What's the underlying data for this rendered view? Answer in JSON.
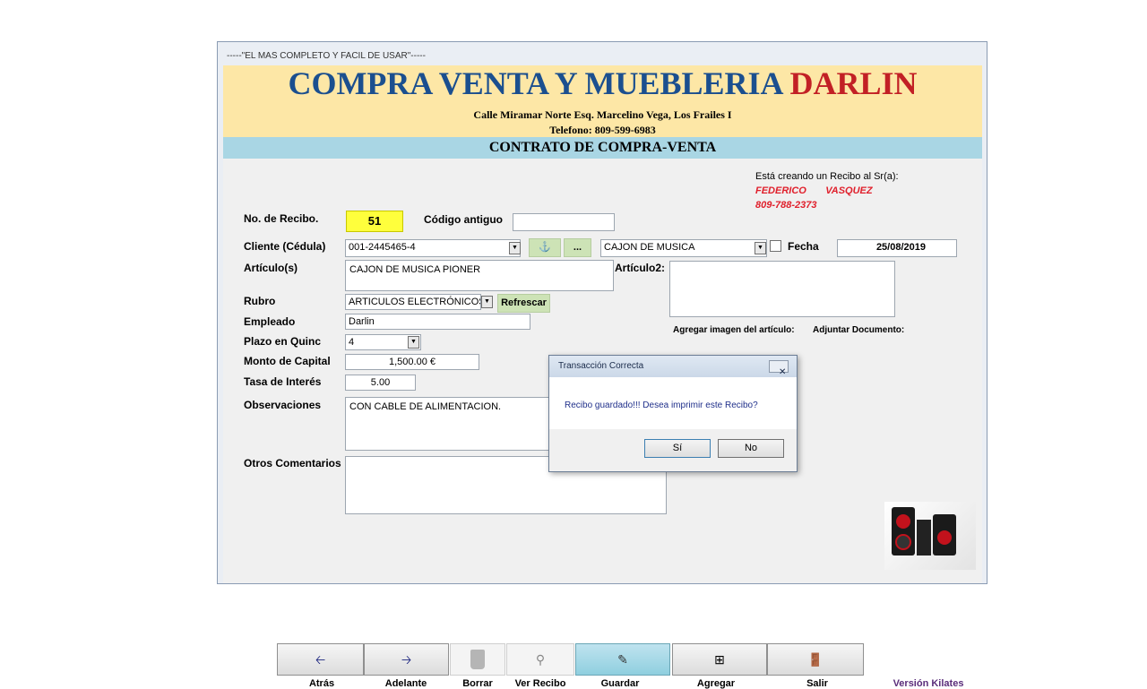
{
  "window": {
    "title": "-----\"EL MAS COMPLETO Y FACIL DE USAR\"-----"
  },
  "header": {
    "brand_main": "COMPRA VENTA Y MUEBLERIA ",
    "brand_accent": "DARLIN",
    "address": "Calle Miramar Norte Esq. Marcelino Vega, Los Frailes I",
    "phone": "Telefono: 809-599-6983",
    "banner": "CONTRATO DE COMPRA-VENTA"
  },
  "info": {
    "creating_text": "Está creando un Recibo al Sr(a):",
    "client_name": "FEDERICO       VASQUEZ",
    "client_phone": "809-788-2373"
  },
  "form": {
    "recibo_label": "No. de Recibo.",
    "recibo_value": "51",
    "codigo_label": "Código antiguo",
    "codigo_value": "",
    "cliente_label": "Cliente (Cédula)",
    "cliente_value": "001-2445465-4",
    "article_select_value": "CAJON DE MUSICA",
    "ellipsis_label": "...",
    "fecha_label": "Fecha",
    "fecha_value": "25/08/2019",
    "articulos_label": "Artículo(s)",
    "articulos_value": "CAJON DE MUSICA PIONER",
    "articulo2_label": "Artículo2:",
    "articulo2_value": "",
    "rubro_label": "Rubro",
    "rubro_value": "ARTICULOS ELECTRÓNICOS",
    "refrescar_label": "Refrescar",
    "empleado_label": "Empleado",
    "empleado_value": "Darlin",
    "plazo_label": "Plazo en Quinc",
    "plazo_value": "4",
    "monto_label": "Monto de Capital",
    "monto_value": "1,500.00 €",
    "tasa_label": "Tasa de Interés",
    "tasa_value": "5.00",
    "observaciones_label": "Observaciones",
    "observaciones_value": "CON CABLE DE ALIMENTACION.",
    "otros_label": "Otros Comentarios",
    "otros_value": "",
    "agregar_imagen_label": "Agregar imagen del artículo:",
    "adjuntar_label": "Adjuntar Documento:"
  },
  "toolbar": {
    "atras": "Atrás",
    "adelante": "Adelante",
    "borrar": "Borrar",
    "ver_recibo": "Ver Recibo",
    "guardar": "Guardar",
    "agregar": "Agregar",
    "salir": "Salir"
  },
  "version": "Versión Kilates",
  "dialog": {
    "title": "Transacción Correcta",
    "message": "Recibo guardado!!!   Desea imprimir este Recibo?",
    "yes": "Sí",
    "no": "No"
  },
  "colors": {
    "brand_blue": "#1b4f8f",
    "brand_red": "#c22025",
    "recibo_highlight": "#ffff3c",
    "banner": "#a9d6e4"
  }
}
